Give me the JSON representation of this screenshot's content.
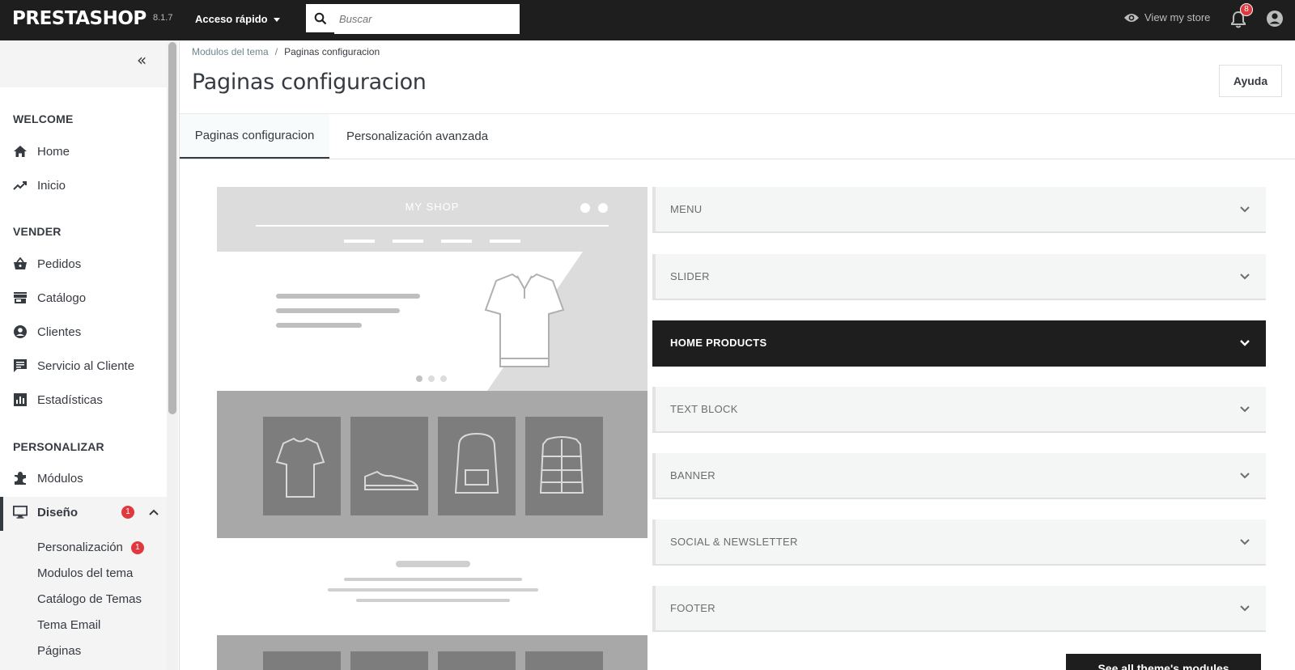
{
  "header": {
    "logo": "PRESTASHOP",
    "version": "8.1.7",
    "quick_access": "Acceso rápido",
    "search_placeholder": "Buscar",
    "view_store": "View my store",
    "notifications_count": "8"
  },
  "sidebar": {
    "sections": [
      {
        "title": "WELCOME",
        "items": [
          "Home",
          "Inicio"
        ]
      },
      {
        "title": "VENDER",
        "items": [
          "Pedidos",
          "Catálogo",
          "Clientes",
          "Servicio al Cliente",
          "Estadísticas"
        ]
      },
      {
        "title": "PERSONALIZAR",
        "items": [
          "Módulos",
          "Diseño"
        ]
      }
    ],
    "design_badge": "1",
    "subitems": [
      "Personalización",
      "Modulos del tema",
      "Catálogo de Temas",
      "Tema Email",
      "Páginas"
    ],
    "personalizacion_badge": "1"
  },
  "breadcrumb": {
    "parent": "Modulos del tema",
    "sep": "/",
    "current": "Paginas configuracion"
  },
  "page": {
    "title": "Paginas configuracion",
    "help_label": "Ayuda",
    "tabs": [
      "Paginas configuracion",
      "Personalización avanzada"
    ]
  },
  "preview": {
    "shop_name": "MY SHOP"
  },
  "accordion": [
    {
      "label": "MENU",
      "active": false
    },
    {
      "label": "SLIDER",
      "active": false
    },
    {
      "label": "HOME PRODUCTS",
      "active": true
    },
    {
      "label": "TEXT BLOCK",
      "active": false
    },
    {
      "label": "BANNER",
      "active": false
    },
    {
      "label": "SOCIAL & NEWSLETTER",
      "active": false
    },
    {
      "label": "FOOTER",
      "active": false
    }
  ],
  "see_all_label": "See all theme's modules",
  "colors": {
    "topbar": "#1e1e1e",
    "accent_red": "#e0383e",
    "panel": "#f4f5f5"
  }
}
